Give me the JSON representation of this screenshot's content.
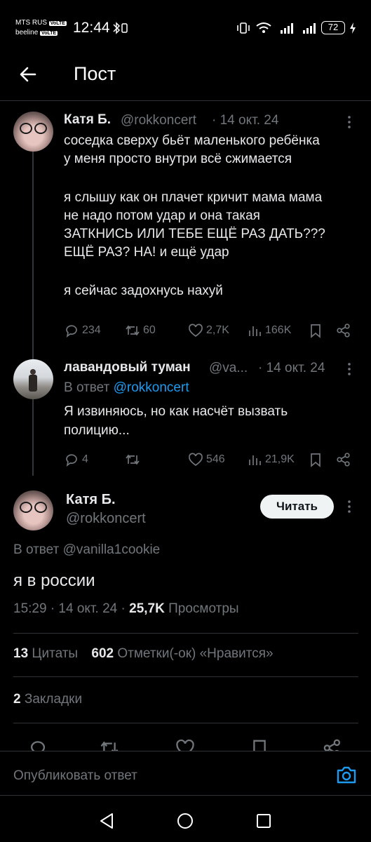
{
  "status_bar": {
    "carrier1": "MTS RUS",
    "carrier2": "beeline",
    "volte": "VoLTE",
    "time": "12:44",
    "battery": "72"
  },
  "header": {
    "title": "Пост"
  },
  "tweet1": {
    "name": "Катя Б.",
    "handle": "@rokkoncert",
    "date": "· 14 окт. 24",
    "lines": [
      "соседка сверху бьёт маленького ребёнка",
      "у меня просто внутри всё сжимается",
      "",
      "я слышу как он плачет кричит мама мама",
      "не надо потом удар и она такая",
      "ЗАТКНИСЬ ИЛИ ТЕБЕ ЕЩЁ РАЗ ДАТЬ???",
      "ЕЩЁ РАЗ? НА! и ещё удар",
      "",
      "я сейчас задохнусь нахуй"
    ],
    "replies": "234",
    "retweets": "60",
    "likes": "2,7K",
    "views": "166K"
  },
  "tweet2": {
    "name": "лавандовый туман",
    "handle": "@va...",
    "date": "· 14 окт. 24",
    "reply_prefix": "В ответ",
    "reply_to": "@rokkoncert",
    "lines": [
      "Я извиняюсь, но как насчёт вызвать",
      "полицию..."
    ],
    "replies": "4",
    "retweets": "",
    "likes": "546",
    "views": "21,9K"
  },
  "main_tweet": {
    "name": "Катя Б.",
    "handle": "@rokkoncert",
    "follow_label": "Читать",
    "reply_info": "В ответ @vanilla1cookie",
    "text": "я в россии",
    "time": "15:29 · 14 окт. 24 ·",
    "views_count": "25,7K",
    "views_label": "Просмотры",
    "quotes_count": "13",
    "quotes_label": "Цитаты",
    "likes_count": "602",
    "likes_label": "Отметки(-ок) «Нравится»",
    "bookmarks_count": "2",
    "bookmarks_label": "Закладки"
  },
  "composer": {
    "placeholder": "Опубликовать ответ"
  },
  "colors": {
    "accent": "#1d9bf0",
    "background": "#000000",
    "muted": "#71767b"
  },
  "icons": [
    "back-arrow-icon",
    "more-icon",
    "reply-icon",
    "retweet-icon",
    "like-icon",
    "views-icon",
    "bookmark-icon",
    "share-icon",
    "camera-icon",
    "nav-back-icon",
    "nav-home-icon",
    "nav-recents-icon"
  ]
}
